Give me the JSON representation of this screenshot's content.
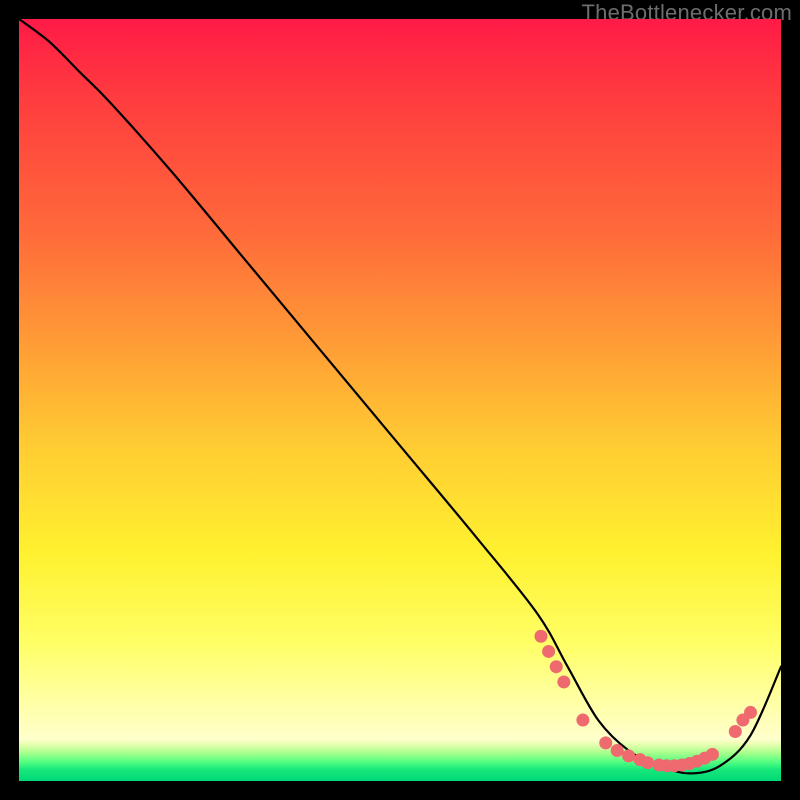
{
  "watermark": "TheBottlenecker.com",
  "colors": {
    "gradient_top": "#ff1a46",
    "gradient_mid": "#fff12f",
    "gradient_bottom": "#00d877",
    "curve": "#000000",
    "dot": "#ef6a6f",
    "page_bg": "#000000"
  },
  "chart_data": {
    "type": "line",
    "title": "",
    "xlabel": "",
    "ylabel": "",
    "xlim": [
      0,
      100
    ],
    "ylim": [
      0,
      100
    ],
    "grid": false,
    "legend": false,
    "series": [
      {
        "name": "bottleneck-curve",
        "x": [
          0,
          4,
          8,
          12,
          20,
          30,
          40,
          50,
          60,
          68,
          72,
          76,
          80,
          84,
          88,
          92,
          96,
          100
        ],
        "y": [
          100,
          97,
          93,
          89,
          80,
          68,
          56,
          44,
          32,
          22,
          15,
          8,
          4,
          2,
          1,
          2,
          6,
          15
        ]
      }
    ],
    "markers": [
      {
        "x": 68.5,
        "y": 19
      },
      {
        "x": 69.5,
        "y": 17
      },
      {
        "x": 70.5,
        "y": 15
      },
      {
        "x": 71.5,
        "y": 13
      },
      {
        "x": 74,
        "y": 8
      },
      {
        "x": 77,
        "y": 5
      },
      {
        "x": 78.5,
        "y": 4
      },
      {
        "x": 80,
        "y": 3.3
      },
      {
        "x": 81.5,
        "y": 2.8
      },
      {
        "x": 82.5,
        "y": 2.4
      },
      {
        "x": 84,
        "y": 2.1
      },
      {
        "x": 85,
        "y": 2.0
      },
      {
        "x": 86,
        "y": 2.0
      },
      {
        "x": 87,
        "y": 2.1
      },
      {
        "x": 88,
        "y": 2.3
      },
      {
        "x": 89,
        "y": 2.6
      },
      {
        "x": 90,
        "y": 3.0
      },
      {
        "x": 91,
        "y": 3.5
      },
      {
        "x": 94,
        "y": 6.5
      },
      {
        "x": 95,
        "y": 8.0
      },
      {
        "x": 96,
        "y": 9.0
      }
    ]
  }
}
